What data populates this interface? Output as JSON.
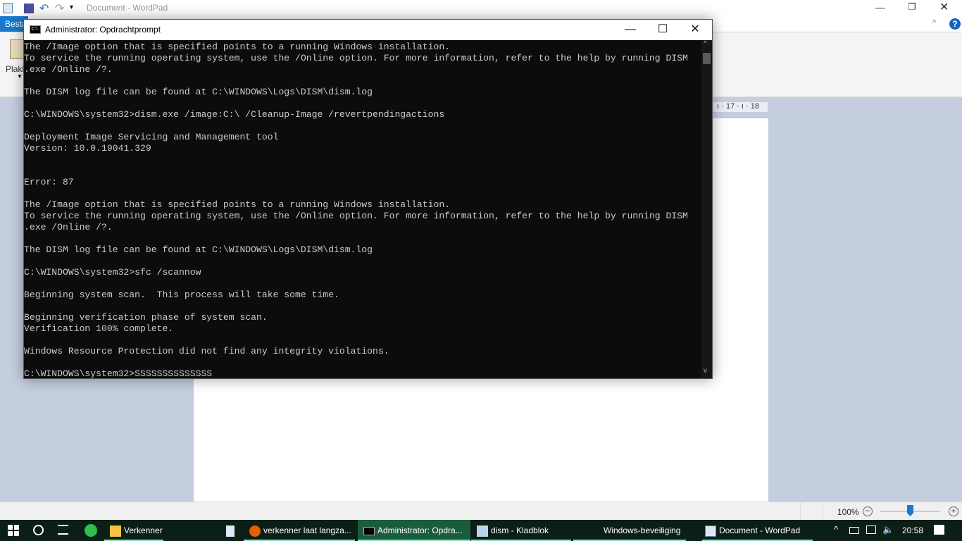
{
  "wordpad": {
    "title": "Document - WordPad",
    "file_tab": "Besta",
    "paste_label": "Plakk",
    "ruler": [
      "17",
      "18"
    ],
    "zoom": "100%",
    "zoom_minus": "−",
    "zoom_plus": "+",
    "help": "?",
    "zoom_slider_percent": 100
  },
  "cmd": {
    "title": "Administrator: Opdrachtprompt",
    "icon_text": "C:\\.",
    "lines": [
      "The /Image option that is specified points to a running Windows installation.",
      "To service the running operating system, use the /Online option. For more information, refer to the help by running DISM",
      ".exe /Online /?.",
      "",
      "The DISM log file can be found at C:\\WINDOWS\\Logs\\DISM\\dism.log",
      "",
      "C:\\WINDOWS\\system32>dism.exe /image:C:\\ /Cleanup-Image /revertpendingactions",
      "",
      "Deployment Image Servicing and Management tool",
      "Version: 10.0.19041.329",
      "",
      "",
      "Error: 87",
      "",
      "The /Image option that is specified points to a running Windows installation.",
      "To service the running operating system, use the /Online option. For more information, refer to the help by running DISM",
      ".exe /Online /?.",
      "",
      "The DISM log file can be found at C:\\WINDOWS\\Logs\\DISM\\dism.log",
      "",
      "C:\\WINDOWS\\system32>sfc /scannow",
      "",
      "Beginning system scan.  This process will take some time.",
      "",
      "Beginning verification phase of system scan.",
      "Verification 100% complete.",
      "",
      "Windows Resource Protection did not find any integrity violations.",
      "",
      "C:\\WINDOWS\\system32>SSSSSSSSSSSSSS"
    ]
  },
  "taskbar": {
    "items": [
      "Verkenner",
      "",
      "verkenner laat langza...",
      "Administrator: Opdra...",
      "dism - Kladblok",
      "Windows-beveiliging",
      "Document - WordPad"
    ],
    "clock": "20:58"
  }
}
